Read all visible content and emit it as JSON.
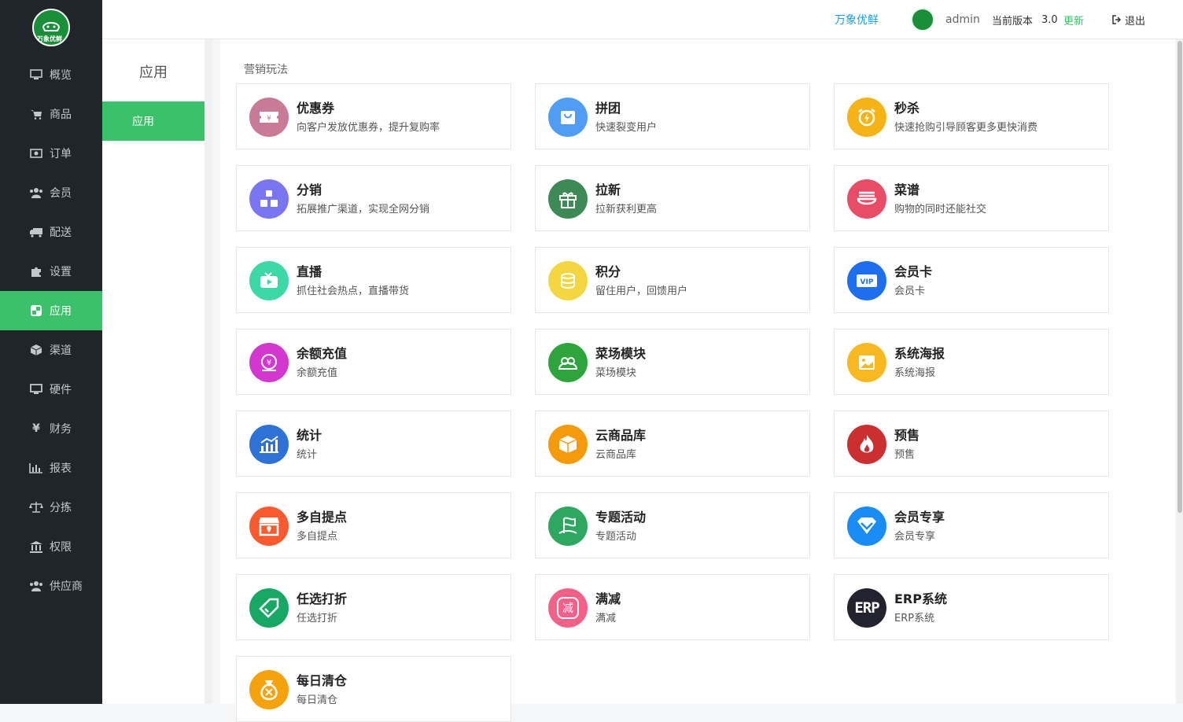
{
  "brand": {
    "logo_text": "万象优鲜",
    "name": "万象优鲜"
  },
  "header": {
    "user": "admin",
    "version_label": "当前版本",
    "version": "3.0",
    "update_label": "更新",
    "logout_label": "退出"
  },
  "sidebar": {
    "items": [
      {
        "label": "概览",
        "icon": "monitor-icon"
      },
      {
        "label": "商品",
        "icon": "cart-icon"
      },
      {
        "label": "订单",
        "icon": "money-icon"
      },
      {
        "label": "会员",
        "icon": "users-icon"
      },
      {
        "label": "配送",
        "icon": "truck-icon"
      },
      {
        "label": "设置",
        "icon": "puzzle-icon"
      },
      {
        "label": "应用",
        "icon": "apps-icon"
      },
      {
        "label": "渠道",
        "icon": "cube-icon"
      },
      {
        "label": "硬件",
        "icon": "desktop-icon"
      },
      {
        "label": "财务",
        "icon": "yen-icon"
      },
      {
        "label": "报表",
        "icon": "bar-chart-icon"
      },
      {
        "label": "分拣",
        "icon": "scale-icon"
      },
      {
        "label": "权限",
        "icon": "bank-icon"
      },
      {
        "label": "供应商",
        "icon": "users-icon"
      }
    ],
    "active": "应用"
  },
  "subnav": {
    "title": "应用",
    "items": [
      {
        "label": "应用"
      }
    ]
  },
  "main": {
    "section_title": "营销玩法",
    "cards": [
      {
        "title": "优惠券",
        "desc": "向客户发放优惠券，提升复购率",
        "icon": "coupon-icon",
        "color": "#c97a96"
      },
      {
        "title": "拼团",
        "desc": "快速裂变用户",
        "icon": "shopping-bag-icon",
        "color": "#4f9df5"
      },
      {
        "title": "秒杀",
        "desc": "快速抢购引导顾客更多更快消费",
        "icon": "alarm-clock-icon",
        "color": "#f6b316"
      },
      {
        "title": "分销",
        "desc": "拓展推广渠道，实现全网分销",
        "icon": "hierarchy-icon",
        "color": "#7a75f2"
      },
      {
        "title": "拉新",
        "desc": "拉新获利更高",
        "icon": "gift-icon",
        "color": "#3e8a56"
      },
      {
        "title": "菜谱",
        "desc": "购物的同时还能社交",
        "icon": "bowl-icon",
        "color": "#e84c67"
      },
      {
        "title": "直播",
        "desc": "抓住社会热点，直播带货",
        "icon": "live-tv-icon",
        "color": "#3cd8a6"
      },
      {
        "title": "积分",
        "desc": "留住用户，回馈用户",
        "icon": "coins-icon",
        "color": "#f4d740"
      },
      {
        "title": "会员卡",
        "desc": "会员卡",
        "icon": "vip-card-icon",
        "color": "#1e6ff0"
      },
      {
        "title": "余额充值",
        "desc": "余额充值",
        "icon": "yen-coin-icon",
        "color": "#d337d0"
      },
      {
        "title": "菜场模块",
        "desc": "菜场模块",
        "icon": "vegetable-icon",
        "color": "#2ea43c"
      },
      {
        "title": "系统海报",
        "desc": "系统海报",
        "icon": "poster-icon",
        "color": "#f8b81f"
      },
      {
        "title": "统计",
        "desc": "统计",
        "icon": "stats-icon",
        "color": "#2e72d8"
      },
      {
        "title": "云商品库",
        "desc": "云商品库",
        "icon": "box-icon",
        "color": "#f59a0a"
      },
      {
        "title": "预售",
        "desc": "预售",
        "icon": "fire-icon",
        "color": "#cc2f2f"
      },
      {
        "title": "多自提点",
        "desc": "多自提点",
        "icon": "store-icon",
        "color": "#fa5a2d"
      },
      {
        "title": "专题活动",
        "desc": "专题活动",
        "icon": "flag-icon",
        "color": "#2ea861"
      },
      {
        "title": "会员专享",
        "desc": "会员专享",
        "icon": "diamond-icon",
        "color": "#1a8cf5"
      },
      {
        "title": "任选打折",
        "desc": "任选打折",
        "icon": "tag-icon",
        "color": "#17a865"
      },
      {
        "title": "满减",
        "desc": "满减",
        "icon": "reduce-icon",
        "color": "#f56088",
        "glyph": "减"
      },
      {
        "title": "ERP系统",
        "desc": "ERP系统",
        "icon": "erp-icon",
        "color": "#23232f",
        "glyph": "ERP"
      },
      {
        "title": "每日清仓",
        "desc": "每日清仓",
        "icon": "money-bag-icon",
        "color": "#f5a20c"
      }
    ]
  }
}
